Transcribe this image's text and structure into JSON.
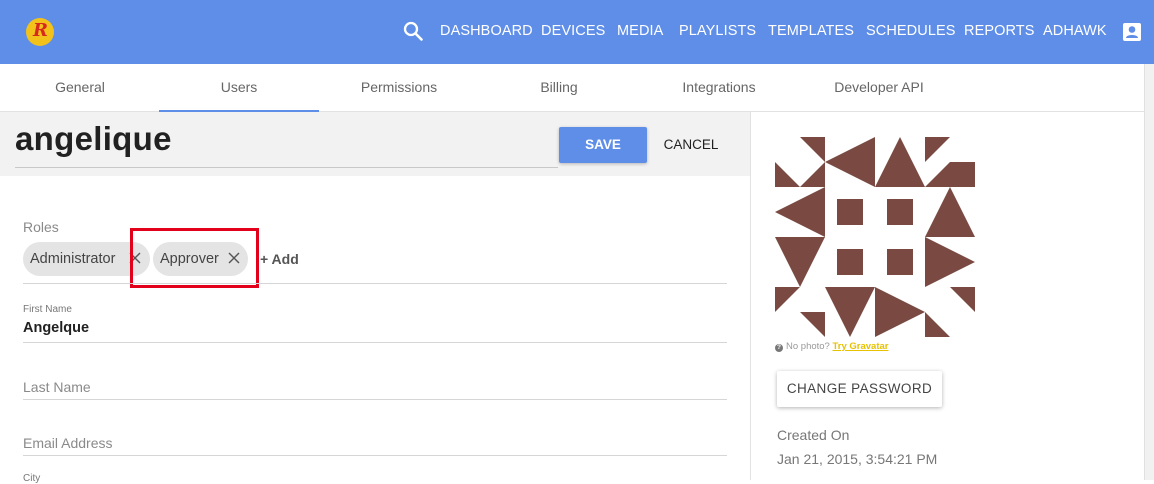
{
  "topbar": {
    "logo_letter": "R",
    "nav": [
      {
        "label": "DASHBOARD",
        "name": "nav-dashboard"
      },
      {
        "label": "DEVICES",
        "name": "nav-devices"
      },
      {
        "label": "MEDIA",
        "name": "nav-media"
      },
      {
        "label": "PLAYLISTS",
        "name": "nav-playlists"
      },
      {
        "label": "TEMPLATES",
        "name": "nav-templates"
      },
      {
        "label": "SCHEDULES",
        "name": "nav-schedules"
      },
      {
        "label": "REPORTS",
        "name": "nav-reports"
      },
      {
        "label": "ADHAWK",
        "name": "nav-adhawk"
      }
    ],
    "icons": [
      "search-icon",
      "account-icon"
    ],
    "color": "#5f8ee8"
  },
  "tabs": [
    {
      "label": "General"
    },
    {
      "label": "Users"
    },
    {
      "label": "Permissions"
    },
    {
      "label": "Billing"
    },
    {
      "label": "Integrations"
    },
    {
      "label": "Developer API"
    }
  ],
  "active_tab": "Users",
  "user": {
    "username": "angelique",
    "save_label": "SAVE",
    "cancel_label": "CANCEL"
  },
  "roles": {
    "label": "Roles",
    "chips": [
      {
        "label": "Administrator"
      },
      {
        "label": "Approver"
      }
    ],
    "add_label": "+ Add"
  },
  "fields": {
    "first_name_label": "First Name",
    "first_name_value": "Angelque",
    "last_name_placeholder": "Last Name",
    "email_placeholder": "Email Address",
    "city_label": "City"
  },
  "profile": {
    "no_photo_text": "No photo?",
    "gravatar_link": "Try Gravatar",
    "change_password_label": "CHANGE PASSWORD",
    "created_label": "Created On",
    "created_value": "Jan 21, 2015, 3:54:21 PM",
    "avatar_color": "#7a4a42"
  }
}
